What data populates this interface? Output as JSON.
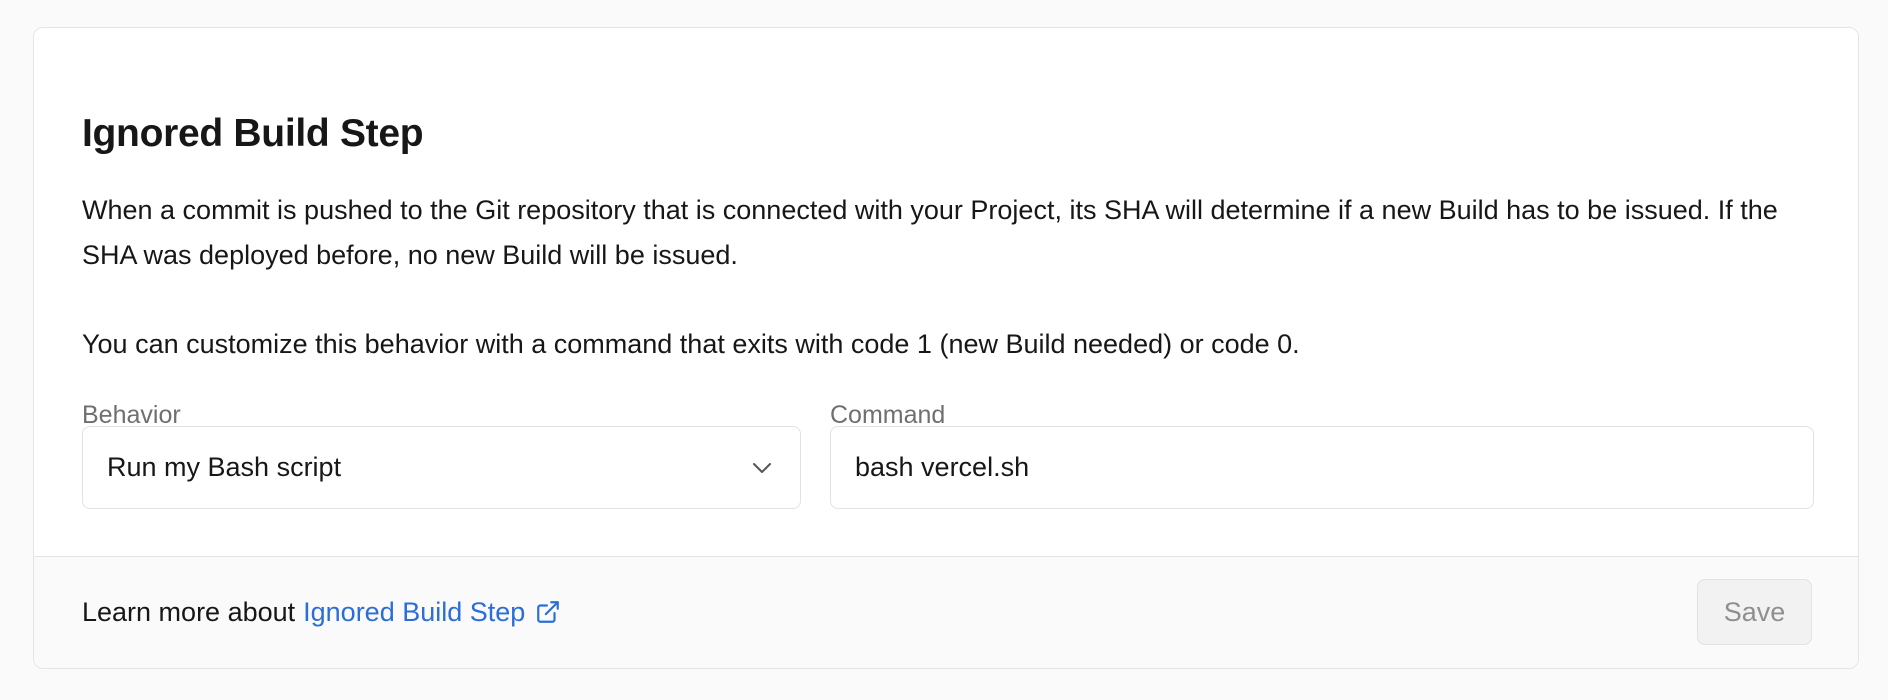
{
  "section": {
    "title": "Ignored Build Step",
    "description": "When a commit is pushed to the Git repository that is connected with your Project, its SHA will determine if a new Build has to be issued. If the SHA was deployed before, no new Build will be issued.",
    "description2": "You can customize this behavior with a command that exits with code 1 (new Build needed) or code 0."
  },
  "form": {
    "behavior_label": "Behavior",
    "behavior_value": "Run my Bash script",
    "command_label": "Command",
    "command_value": "bash vercel.sh"
  },
  "footer": {
    "learn_prefix": "Learn more about",
    "learn_link": "Ignored Build Step",
    "link_icon": "external-link-icon",
    "save_label": "Save"
  },
  "colors": {
    "link": "#2a6ed8",
    "footer_bg": "#fafafa",
    "disabled_text": "#8f8f8f"
  }
}
